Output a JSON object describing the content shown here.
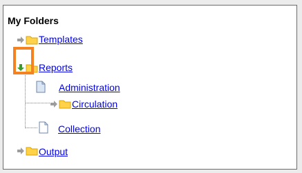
{
  "panel": {
    "title": "My Folders",
    "items": [
      {
        "label": "Templates"
      },
      {
        "label": "Reports"
      },
      {
        "label": "Administration"
      },
      {
        "label": "Circulation"
      },
      {
        "label": "Collection"
      },
      {
        "label": "Output"
      }
    ]
  },
  "colors": {
    "link": "#0000ee",
    "highlight": "#f58220",
    "folder": "#ffd24a",
    "arrow_grey": "#9c9c9c",
    "arrow_green": "#3f9a2d"
  },
  "icons": {
    "expand_arrow": "right-arrow-icon",
    "expanded_arrow": "down-arrow-icon",
    "folder": "folder-icon",
    "document": "document-icon"
  }
}
